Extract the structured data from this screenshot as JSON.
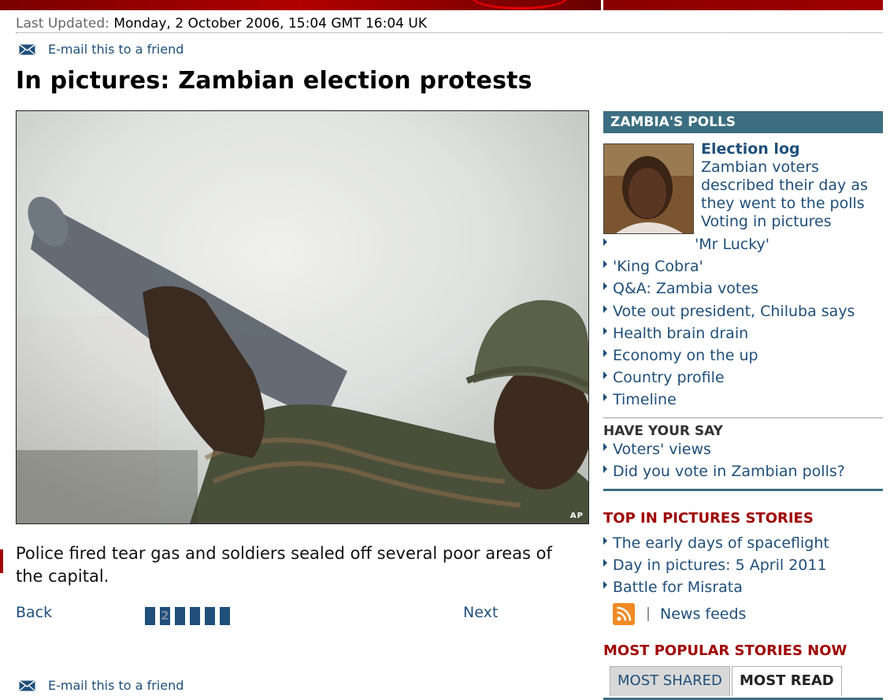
{
  "meta": {
    "last_updated_label": "Last Updated:",
    "last_updated_value": "Monday, 2 October 2006, 15:04 GMT 16:04 UK"
  },
  "email_link": "E-mail this to a friend",
  "title": "In pictures: Zambian election protests",
  "photo": {
    "credit": "AP"
  },
  "caption": "Police fired tear gas and soldiers sealed off several poor areas of the capital.",
  "nav": {
    "back": "Back",
    "next": "Next",
    "pages": [
      "",
      "2",
      "",
      "",
      "",
      ""
    ],
    "current_page": "2"
  },
  "sidebar": {
    "section_title": "ZAMBIA'S POLLS",
    "election_log": {
      "title": "Election log",
      "description": "Zambian voters described their day as they went to the polls",
      "link": "Voting in pictures"
    },
    "links": [
      "'Mr Lucky'",
      "'King Cobra'",
      "Q&A: Zambia votes",
      "Vote out president, Chiluba says",
      "Health brain drain",
      "Economy on the up",
      "Country profile",
      "Timeline"
    ],
    "have_your_say": {
      "title": "HAVE YOUR SAY",
      "links": [
        "Voters' views",
        "Did you vote in Zambian polls?"
      ]
    },
    "top_pictures": {
      "title": "TOP IN PICTURES STORIES",
      "links": [
        "The early days of spaceflight",
        "Day in pictures: 5 April 2011",
        "Battle for Misrata"
      ]
    },
    "news_feeds": "News feeds",
    "most_popular": {
      "title": "MOST POPULAR STORIES NOW",
      "tabs": [
        "MOST SHARED",
        "MOST READ"
      ],
      "active_tab": "MOST READ"
    }
  },
  "colors": {
    "link": "#1f4f7a",
    "section_bar": "#3b6e80",
    "accent_red": "#a00000"
  }
}
